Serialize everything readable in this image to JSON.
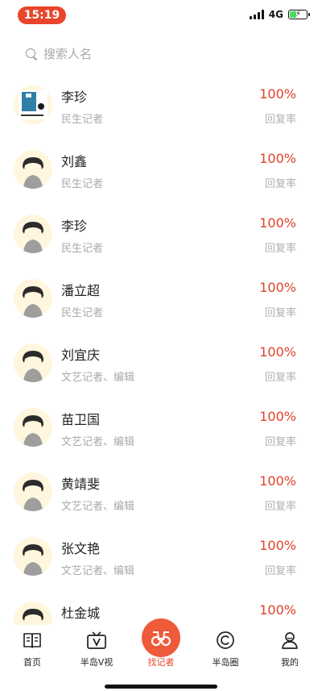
{
  "status_bar": {
    "time": "15:19",
    "network": "4G"
  },
  "search": {
    "placeholder": "搜索人名"
  },
  "reporters": [
    {
      "name": "李珍",
      "role": "民生记者",
      "rate": "100%",
      "rate_label": "回复率",
      "avatar": "custom-image"
    },
    {
      "name": "刘鑫",
      "role": "民生记者",
      "rate": "100%",
      "rate_label": "回复率",
      "avatar": "default"
    },
    {
      "name": "李珍",
      "role": "民生记者",
      "rate": "100%",
      "rate_label": "回复率",
      "avatar": "default"
    },
    {
      "name": "潘立超",
      "role": "民生记者",
      "rate": "100%",
      "rate_label": "回复率",
      "avatar": "default"
    },
    {
      "name": "刘宜庆",
      "role": "文艺记者、编辑",
      "rate": "100%",
      "rate_label": "回复率",
      "avatar": "default"
    },
    {
      "name": "苗卫国",
      "role": "文艺记者、编辑",
      "rate": "100%",
      "rate_label": "回复率",
      "avatar": "default"
    },
    {
      "name": "黄靖斐",
      "role": "文艺记者、编辑",
      "rate": "100%",
      "rate_label": "回复率",
      "avatar": "default"
    },
    {
      "name": "张文艳",
      "role": "文艺记者、编辑",
      "rate": "100%",
      "rate_label": "回复率",
      "avatar": "default"
    },
    {
      "name": "杜金城",
      "role": "",
      "rate": "100%",
      "rate_label": "",
      "avatar": "default"
    }
  ],
  "nav": {
    "items": [
      {
        "label": "首页",
        "icon": "book-icon"
      },
      {
        "label": "半岛V视",
        "icon": "tv-icon"
      },
      {
        "label": "找记者",
        "icon": "binoculars-icon",
        "active": true
      },
      {
        "label": "半岛圈",
        "icon": "circle-c-icon"
      },
      {
        "label": "我的",
        "icon": "person-icon"
      }
    ]
  },
  "colors": {
    "accent": "#e8452b",
    "rate": "#e0412a",
    "avatar_bg": "#fff6de"
  }
}
